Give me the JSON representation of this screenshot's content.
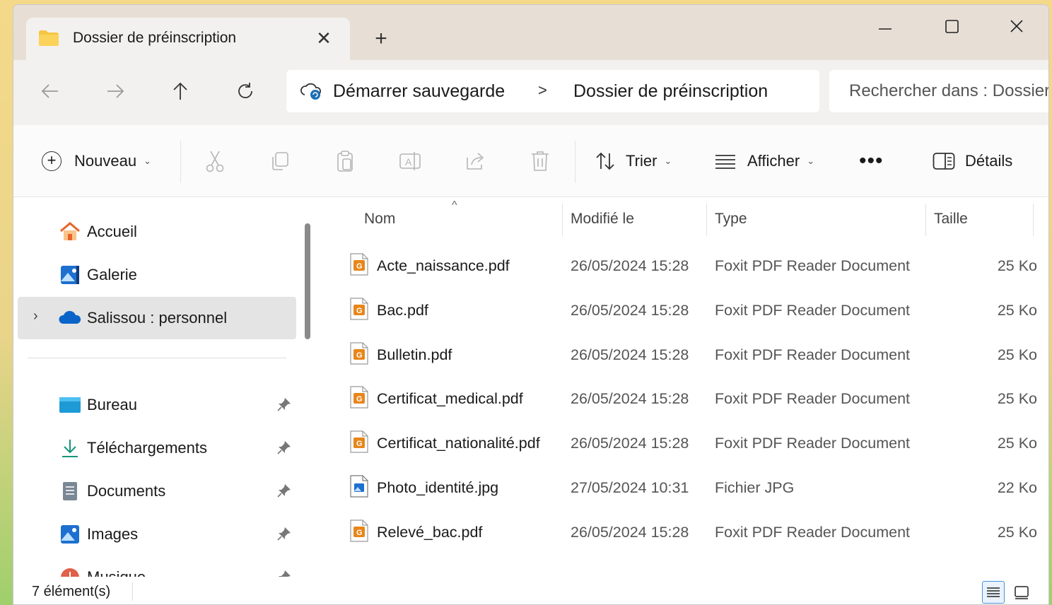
{
  "tab": {
    "title": "Dossier de préinscription"
  },
  "address": {
    "crumbs": [
      "Démarrer sauvegarde",
      "Dossier de préinscription"
    ],
    "separator": ">",
    "search_placeholder": "Rechercher dans : Dossier de préinscription"
  },
  "commandbar": {
    "new_label": "Nouveau",
    "sort_label": "Trier",
    "view_label": "Afficher",
    "more_label": "•••",
    "details_label": "Détails"
  },
  "sidebar": {
    "items": [
      {
        "label": "Accueil",
        "icon": "home-icon"
      },
      {
        "label": "Galerie",
        "icon": "gallery-icon"
      },
      {
        "label": "Salissou : personnel",
        "icon": "onedrive-cloud-icon",
        "selected": true
      },
      {
        "label": "Bureau",
        "icon": "desktop-icon",
        "pinned": true
      },
      {
        "label": "Téléchargements",
        "icon": "download-icon",
        "pinned": true
      },
      {
        "label": "Documents",
        "icon": "documents-icon",
        "pinned": true
      },
      {
        "label": "Images",
        "icon": "pictures-icon",
        "pinned": true
      },
      {
        "label": "Musique",
        "icon": "music-icon",
        "pinned": true
      }
    ]
  },
  "table": {
    "columns": [
      "Nom",
      "Modifié le",
      "Type",
      "Taille"
    ],
    "rows": [
      {
        "name": "Acte_naissance.pdf",
        "modified": "26/05/2024 15:28",
        "type": "Foxit PDF Reader Document",
        "size": "25 Ko",
        "icon": "pdf-icon"
      },
      {
        "name": "Bac.pdf",
        "modified": "26/05/2024 15:28",
        "type": "Foxit PDF Reader Document",
        "size": "25 Ko",
        "icon": "pdf-icon"
      },
      {
        "name": "Bulletin.pdf",
        "modified": "26/05/2024 15:28",
        "type": "Foxit PDF Reader Document",
        "size": "25 Ko",
        "icon": "pdf-icon"
      },
      {
        "name": "Certificat_medical.pdf",
        "modified": "26/05/2024 15:28",
        "type": "Foxit PDF Reader Document",
        "size": "25 Ko",
        "icon": "pdf-icon"
      },
      {
        "name": "Certificat_nationalité.pdf",
        "modified": "26/05/2024 15:28",
        "type": "Foxit PDF Reader Document",
        "size": "25 Ko",
        "icon": "pdf-icon"
      },
      {
        "name": "Photo_identité.jpg",
        "modified": "27/05/2024 10:31",
        "type": "Fichier JPG",
        "size": "22 Ko",
        "icon": "image-file-icon"
      },
      {
        "name": "Relevé_bac.pdf",
        "modified": "26/05/2024 15:28",
        "type": "Foxit PDF Reader Document",
        "size": "25 Ko",
        "icon": "pdf-icon"
      }
    ]
  },
  "status": {
    "count": "7 élément(s)"
  },
  "colors": {
    "accent": "#0067c0",
    "pdf_orange": "#e8861a",
    "folder_yellow": "#f5c542"
  }
}
